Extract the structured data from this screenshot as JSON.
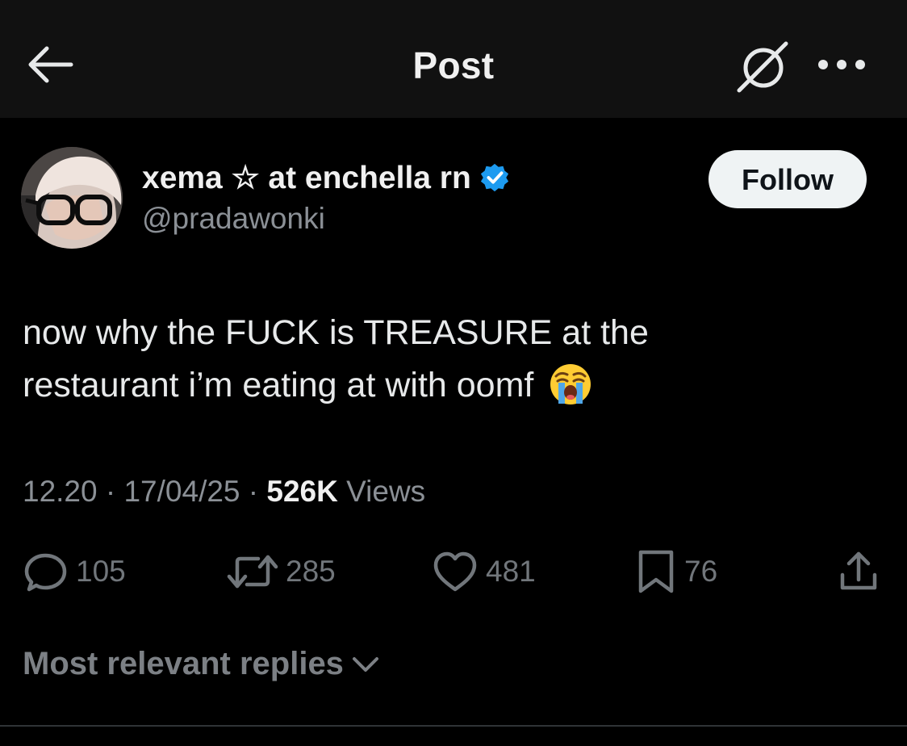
{
  "header": {
    "title": "Post",
    "back_icon": "arrow-left-icon",
    "grok_icon": "grok-icon",
    "more_icon": "more-horizontal-icon"
  },
  "author": {
    "display_name": "xema ☆ at enchella rn",
    "handle": "@pradawonki",
    "verified": true,
    "follow_label": "Follow"
  },
  "post": {
    "text_line1": "now why the FUCK is TREASURE at the",
    "text_line2": "restaurant i’m eating at with oomf",
    "emoji": "loudly-crying-face",
    "time": "12.20",
    "sep1": " · ",
    "date": "17/04/25",
    "sep2": " · ",
    "views_count": "526K",
    "views_label": " Views"
  },
  "actions": {
    "replies": "105",
    "reposts": "285",
    "likes": "481",
    "bookmarks": "76"
  },
  "replies_sort": {
    "label": "Most relevant replies",
    "icon": "chevron-down-icon"
  },
  "colors": {
    "background": "#000000",
    "header_bg": "#111111",
    "text_primary": "#e7e9ea",
    "text_secondary": "#8b9096",
    "verified_blue": "#1d9bf0",
    "follow_bg": "#eff3f4"
  }
}
